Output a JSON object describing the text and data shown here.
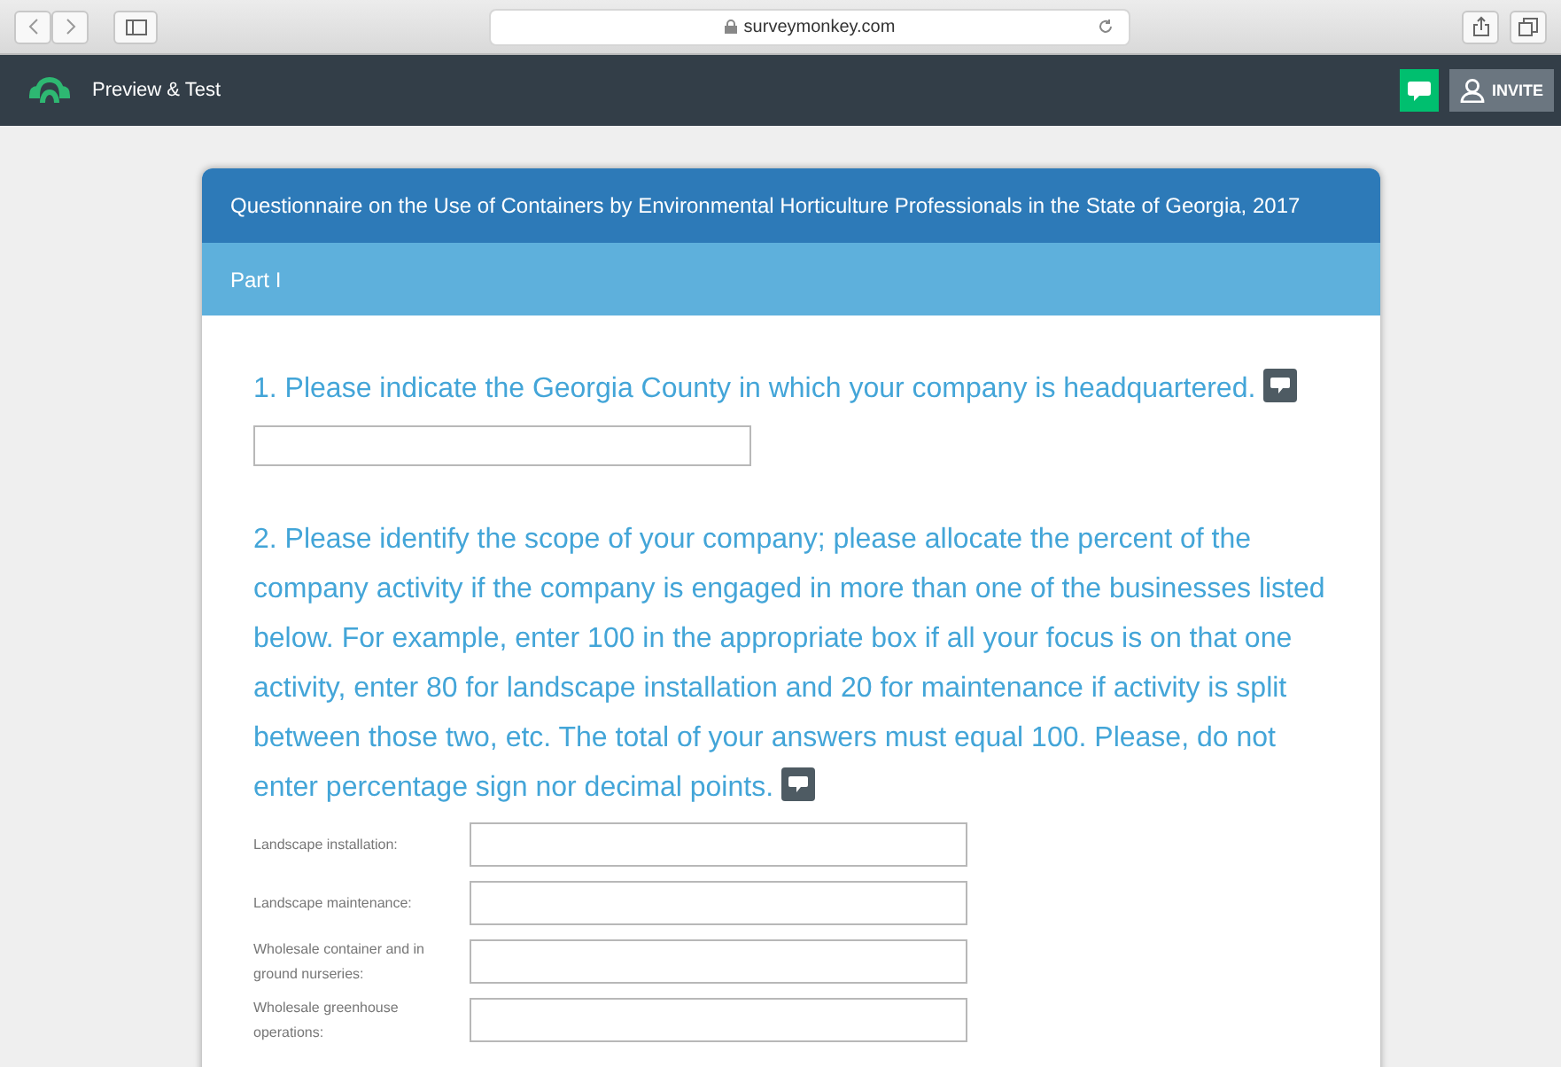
{
  "browser": {
    "url": "surveymonkey.com"
  },
  "app_bar": {
    "title": "Preview & Test",
    "invite_label": "INVITE"
  },
  "survey": {
    "title": "Questionnaire on the Use of Containers by Environmental Horticulture Professionals in the State of Georgia, 2017",
    "page_title": "Part I",
    "questions": [
      {
        "text": "1. Please indicate the Georgia County in which your company is headquartered.",
        "kind": "single"
      },
      {
        "text": "2. Please identify the scope of your company; please allocate the percent of the company activity if the company is engaged in more than one of the businesses listed below. For example, enter 100 in the appropriate box if all your focus is on that one activity, enter 80 for landscape installation and 20 for maintenance if activity is split between those two, etc. The total of your answers must equal 100. Please, do not enter percentage sign nor decimal points.",
        "kind": "multi",
        "fields": [
          {
            "label": "Landscape installation:"
          },
          {
            "label": "Landscape maintenance:"
          },
          {
            "label": "Wholesale container and in ground nurseries:"
          },
          {
            "label": "Wholesale greenhouse operations:"
          }
        ]
      }
    ]
  }
}
